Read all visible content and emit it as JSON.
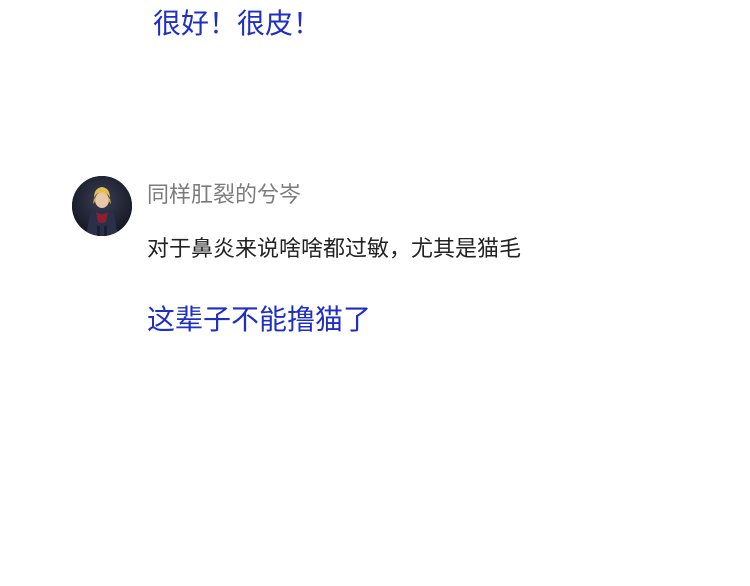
{
  "captions": {
    "top": "很好！很皮！",
    "bottom": "这辈子不能撸猫了"
  },
  "comment": {
    "username": "同样肛裂的兮岑",
    "text": "对于鼻炎来说啥啥都过敏，尤其是猫毛",
    "avatar": "anime-character-avatar"
  },
  "colors": {
    "caption": "#1f2fc4",
    "username": "#7b7b7b",
    "text": "#222222",
    "background": "#ffffff"
  }
}
